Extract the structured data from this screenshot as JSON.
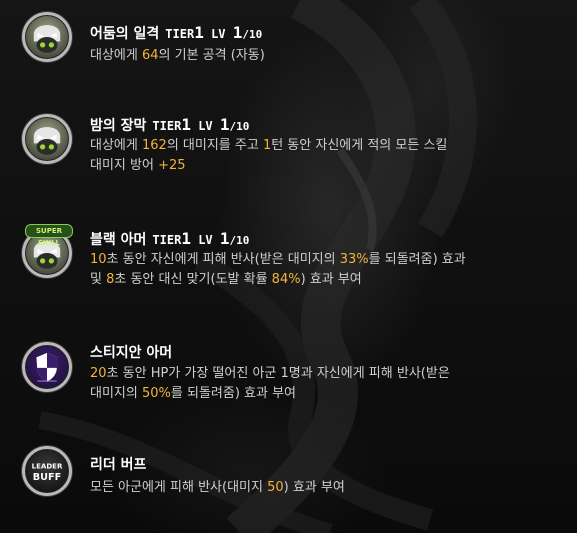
{
  "skills": [
    {
      "icon": "masked-portrait-icon",
      "name": "어둠의 일격",
      "tier_label": "TIER",
      "tier": "1",
      "lv_label": "LV",
      "level": "1",
      "max_level": "/10",
      "desc_line1": [
        "대상에게 ",
        "64",
        "의 기본 공격 (자동)"
      ]
    },
    {
      "icon": "masked-portrait-icon",
      "name": "밤의 장막",
      "tier_label": "TIER",
      "tier": "1",
      "lv_label": "LV",
      "level": "1",
      "max_level": "/10",
      "desc_line1": [
        "대상에게 ",
        "162",
        "의 대미지를 주고 ",
        "1",
        "턴 동안 자신에게 적의 모든 스킬"
      ],
      "desc_line2": [
        "대미지 방어 ",
        "+25"
      ]
    },
    {
      "icon": "masked-portrait-icon",
      "badge": "SUPER SKILL",
      "name": "블랙 아머",
      "tier_label": "TIER",
      "tier": "1",
      "lv_label": "LV",
      "level": "1",
      "max_level": "/10",
      "desc_line1": [
        "10",
        "초 동안 자신에게 피해 반사(받은 대미지의 ",
        "33%",
        "를 되돌려줌) 효과"
      ],
      "desc_line2": [
        "및 ",
        "8",
        "초 동안 대신 맞기(도발 확률 ",
        "84%",
        ") 효과 부여"
      ]
    },
    {
      "icon": "shield-icon",
      "name": "스티지안 아머",
      "desc_line1": [
        "20",
        "초 동안 HP가 가장 떨어진 아군 1명과 자신에게 피해 반사(받은"
      ],
      "desc_line2": [
        "대미지의 ",
        "50%",
        "를 되돌려줌) 효과 부여"
      ]
    },
    {
      "icon": "leader-buff-icon",
      "icon_text_top": "LEADER",
      "icon_text_bottom": "BUFF",
      "name": "리더 버프",
      "desc_line1": [
        "모든 아군에게 피해 반사(대미지 ",
        "50",
        ") 효과 부여"
      ]
    }
  ],
  "colors": {
    "highlight": "#f2b43a",
    "text": "#cfcfcf",
    "title": "#ffffff",
    "shield_purple": "#3a1e6b"
  }
}
